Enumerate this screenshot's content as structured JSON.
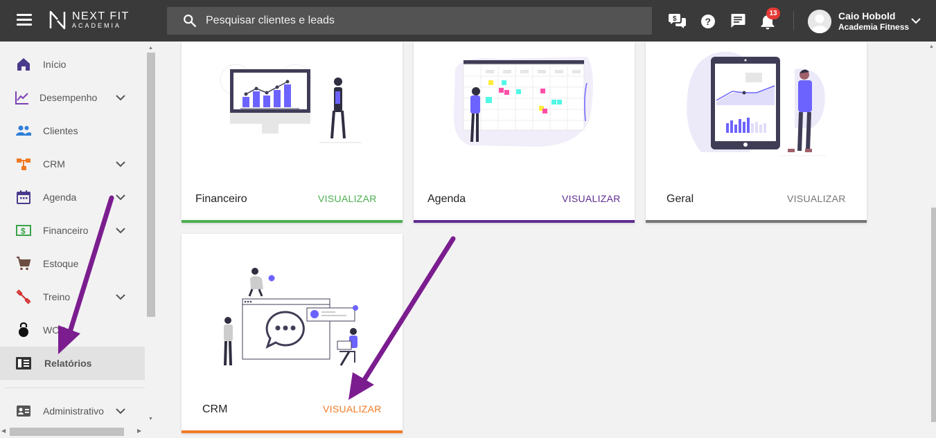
{
  "header": {
    "logo_name": "NEXT FIT",
    "logo_sub": "ACADEMIA",
    "search_placeholder": "Pesquisar clientes e leads",
    "notification_count": "13",
    "user_name": "Caio Hobold",
    "user_org": "Academia Fitness",
    "icons": [
      "menu-icon",
      "search-icon",
      "money-chat-icon",
      "help-icon",
      "chat-icon",
      "bell-icon",
      "chevron-down-icon"
    ]
  },
  "sidebar": {
    "items": [
      {
        "label": "Início",
        "icon": "home-icon",
        "color": "#4a3a8c",
        "chevron": false
      },
      {
        "label": "Desempenho",
        "icon": "chart-line-icon",
        "color": "#7b3fb5",
        "chevron": true
      },
      {
        "label": "Clientes",
        "icon": "people-icon",
        "color": "#2f7fd8",
        "chevron": false
      },
      {
        "label": "CRM",
        "icon": "crm-nodes-icon",
        "color": "#f07a24",
        "chevron": true
      },
      {
        "label": "Agenda",
        "icon": "calendar-icon",
        "color": "#4a3a8c",
        "chevron": true
      },
      {
        "label": "Financeiro",
        "icon": "money-icon",
        "color": "#3aa34a",
        "chevron": true
      },
      {
        "label": "Estoque",
        "icon": "cart-icon",
        "color": "#6d4c41",
        "chevron": false
      },
      {
        "label": "Treino",
        "icon": "dumbbell-icon",
        "color": "#d32f2f",
        "chevron": true
      },
      {
        "label": "WOD",
        "icon": "kettlebell-icon",
        "color": "#111111",
        "chevron": false
      },
      {
        "label": "Relatórios",
        "icon": "report-icon",
        "color": "#333333",
        "chevron": false,
        "active": true
      },
      {
        "label": "Administrativo",
        "icon": "id-card-icon",
        "color": "#555555",
        "chevron": true
      }
    ]
  },
  "cards": [
    {
      "title": "Financeiro",
      "action": "VISUALIZAR",
      "color": "#4caf50"
    },
    {
      "title": "Agenda",
      "action": "VISUALIZAR",
      "color": "#5e2d91"
    },
    {
      "title": "Geral",
      "action": "VISUALIZAR",
      "color": "#757575"
    },
    {
      "title": "CRM",
      "action": "VISUALIZAR",
      "color": "#f07a24"
    }
  ],
  "annotation_color": "#7b1d8f"
}
